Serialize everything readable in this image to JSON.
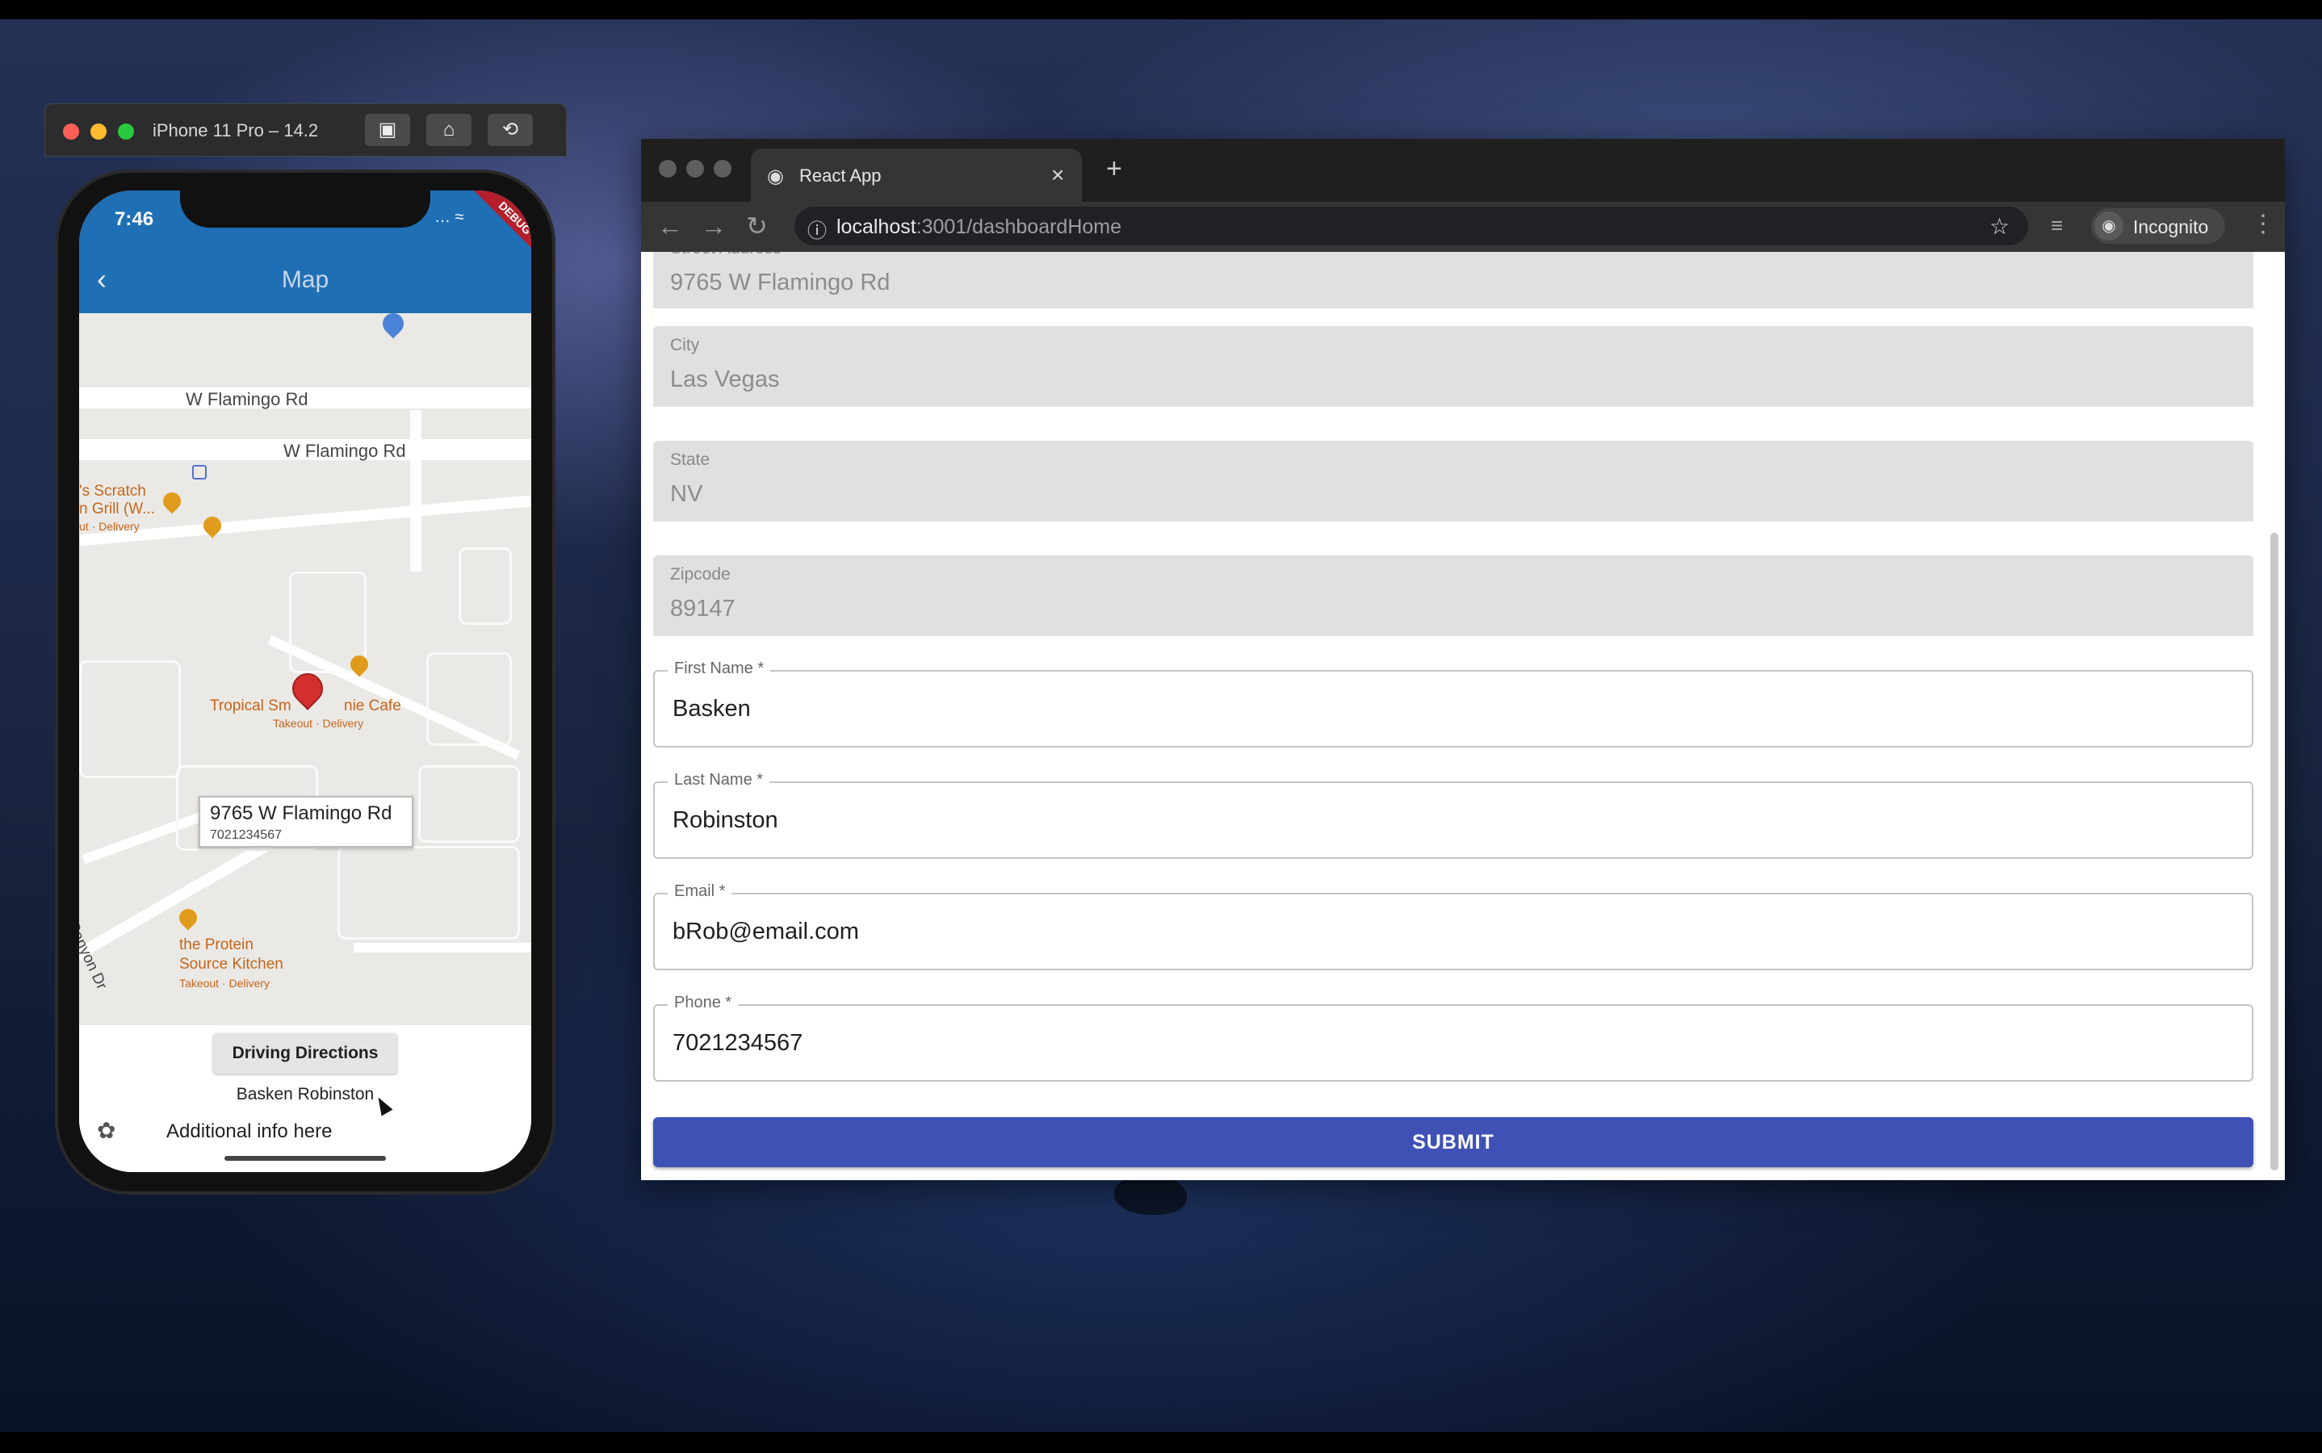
{
  "simulator": {
    "title": "iPhone 11 Pro – 14.2",
    "buttons": [
      "screenshot-icon",
      "home-icon",
      "rotate-icon"
    ]
  },
  "phone": {
    "status_time": "7:46",
    "debug_badge": "DEBUG",
    "appbar_title": "Map",
    "appbar_color": "#1f6fb5",
    "map": {
      "roads": [
        "W Flamingo Rd",
        "W Flamingo Rd",
        "Canyon Dr"
      ],
      "pois": [
        {
          "name": "'s Scratch",
          "line2": "n Grill (W...",
          "sub": "ut · Delivery"
        },
        {
          "name": "Tropical Sm",
          "name_end": "nie Cafe",
          "sub": "Takeout · Delivery"
        },
        {
          "name": "the Protein",
          "line2": "Source Kitchen",
          "sub": "Takeout · Delivery"
        }
      ],
      "infowindow": {
        "title": "9765 W Flamingo Rd",
        "subtitle": "7021234567"
      }
    },
    "driving_button": "Driving Directions",
    "person_name": "Basken Robinston",
    "info_text": "Additional info here"
  },
  "browser": {
    "tab_title": "React App",
    "url_host": "localhost",
    "url_path": ":3001/dashboardHome",
    "profile_label": "Incognito",
    "form": {
      "filled_fields": [
        {
          "label": "Street Address",
          "value": "9765 W Flamingo Rd"
        },
        {
          "label": "City",
          "value": "Las Vegas"
        },
        {
          "label": "State",
          "value": "NV"
        },
        {
          "label": "Zipcode",
          "value": "89147"
        }
      ],
      "outlined_fields": [
        {
          "label": "First Name *",
          "value": "Basken"
        },
        {
          "label": "Last Name *",
          "value": "Robinston"
        },
        {
          "label": "Email *",
          "value": "bRob@email.com"
        },
        {
          "label": "Phone *",
          "value": "7021234567"
        }
      ],
      "submit_label": "SUBMIT",
      "submit_color": "#3f51b5"
    }
  }
}
